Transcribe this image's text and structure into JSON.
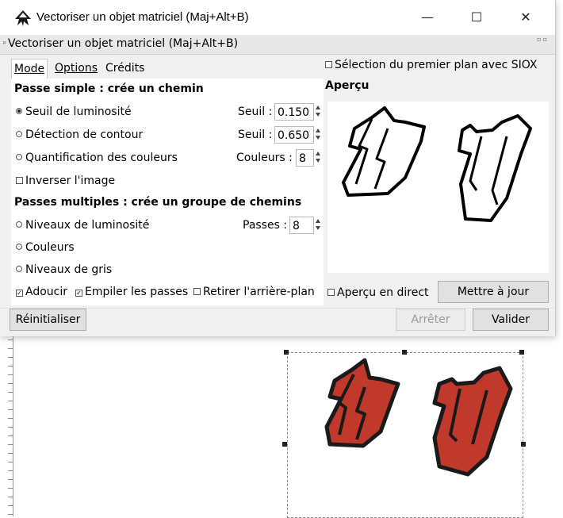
{
  "window": {
    "title": "Vectoriser un objet matriciel (Maj+Alt+B)",
    "minimize": "—",
    "maximize": "☐",
    "close": "✕"
  },
  "dock": {
    "title": "Vectoriser un objet matriciel (Maj+Alt+B)",
    "grip": "ᵖ",
    "mini": "▫▫"
  },
  "tabs": [
    "Mode",
    "Options",
    "Crédits"
  ],
  "siox": {
    "label": "Sélection du premier plan avec SIOX",
    "checked": false
  },
  "preview": {
    "heading": "Aperçu"
  },
  "single_scan": {
    "heading": "Passe simple : crée un chemin",
    "brightness": {
      "label": "Seuil de luminosité",
      "selected": true,
      "field_label": "Seuil :",
      "value": "0.150"
    },
    "edge": {
      "label": "Détection de contour",
      "selected": false,
      "field_label": "Seuil :",
      "value": "0.650"
    },
    "colors": {
      "label": "Quantification des couleurs",
      "selected": false,
      "field_label": "Couleurs :",
      "value": "8"
    },
    "invert": {
      "label": "Inverser l'image",
      "checked": false
    }
  },
  "multi_scan": {
    "heading": "Passes multiples : crée un groupe de chemins",
    "brightness_steps": {
      "label": "Niveaux de luminosité",
      "selected": false,
      "field_label": "Passes :",
      "value": "8"
    },
    "colors": {
      "label": "Couleurs",
      "selected": false
    },
    "grays": {
      "label": "Niveaux de gris",
      "selected": false
    },
    "smooth": {
      "label": "Adoucir",
      "checked": true
    },
    "stack": {
      "label": "Empiler les passes",
      "checked": true
    },
    "remove_bg": {
      "label": "Retirer l'arrière-plan",
      "checked": false
    }
  },
  "live_preview": {
    "label": "Aperçu en direct",
    "checked": false
  },
  "buttons": {
    "update": "Mettre à jour",
    "reset": "Réinitialiser",
    "stop": "Arrêter",
    "ok": "Valider"
  },
  "colors": {
    "dialog_bg": "#f0f0f0",
    "shape_red": "#c0392b",
    "disabled_text": "#9a9a9a"
  }
}
